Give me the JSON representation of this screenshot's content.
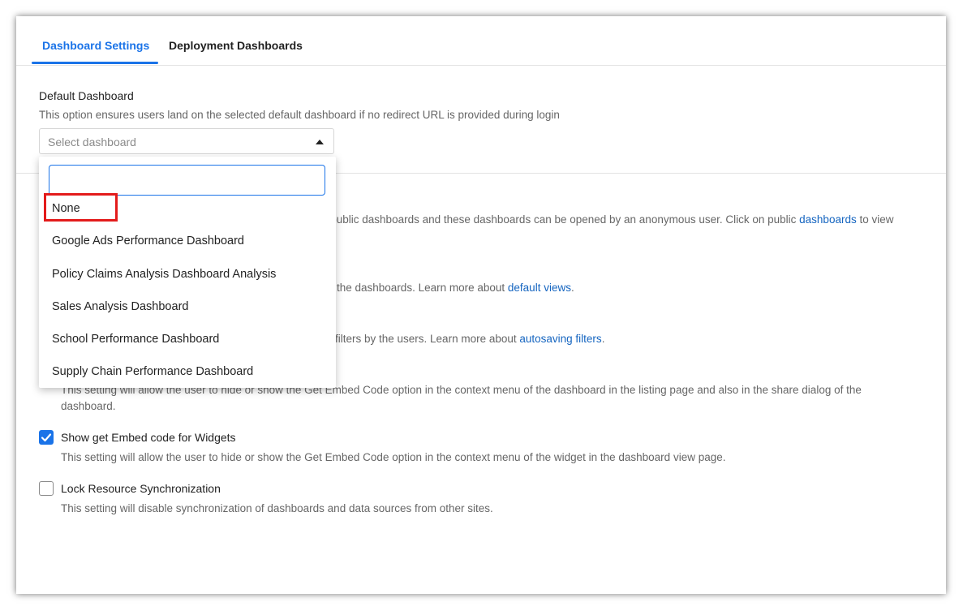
{
  "tabs": [
    {
      "label": "Dashboard Settings",
      "active": true
    },
    {
      "label": "Deployment Dashboards",
      "active": false
    }
  ],
  "default_dashboard": {
    "label": "Default Dashboard",
    "description": "This option ensures users land on the selected default dashboard if no redirect URL is provided during login",
    "select_placeholder": "Select dashboard",
    "dropdown_search_value": "",
    "options": [
      "None",
      "Google Ads Performance Dashboard",
      "Policy Claims Analysis Dashboard Analysis",
      "Sales Analysis Dashboard",
      "School Performance Dashboard",
      "Supply Chain Performance Dashboard"
    ]
  },
  "obscured_texts": {
    "public_text": "e public dashboards and these dashboards can be opened by an anonymous user. Click on public ",
    "public_link": "dashboards",
    "public_suffix": " to view",
    "views_text": "the dashboards. Learn more about ",
    "views_link": "default views",
    "views_suffix": ".",
    "filters_text": "filters by the users. Learn more about ",
    "filters_link": "autosaving filters",
    "filters_suffix": "."
  },
  "embed_dashboard": {
    "description_line1": "This setting will allow the user to hide or show the Get Embed Code option in the context menu of the dashboard in the listing page and also in the share dialog of the",
    "description_line2": "dashboard."
  },
  "settings": [
    {
      "label": "Show get Embed code for Widgets",
      "checked": true,
      "description": "This setting will allow the user to hide or show the Get Embed Code option in the context menu of the widget in the dashboard view page."
    },
    {
      "label": "Lock Resource Synchronization",
      "checked": false,
      "description": "This setting will disable synchronization of dashboards and data sources from other sites."
    }
  ],
  "colors": {
    "accent": "#1a73e8",
    "highlight": "#e31b1b",
    "link": "#1565c0"
  }
}
